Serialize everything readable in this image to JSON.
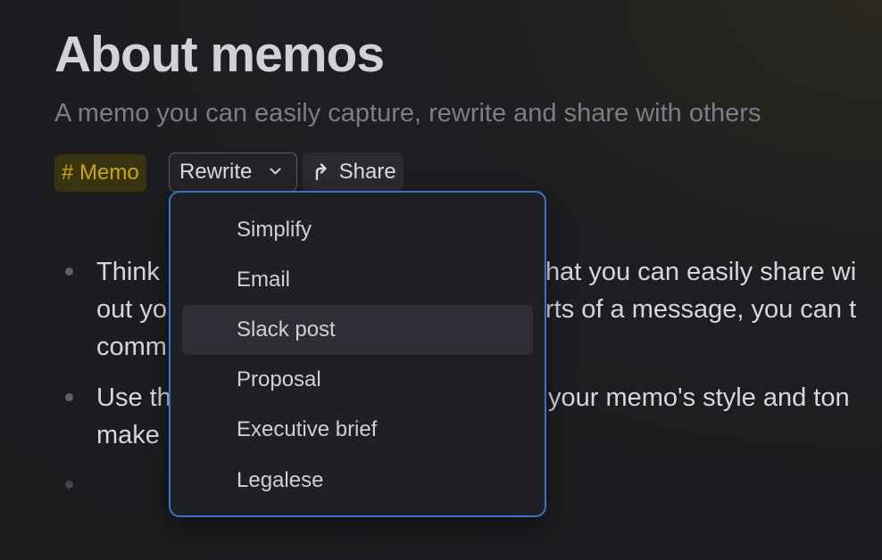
{
  "page": {
    "title": "About memos",
    "subtitle": "A memo you can easily capture, rewrite and share with others"
  },
  "toolbar": {
    "tag_label": "# Memo",
    "rewrite_label": "Rewrite",
    "rewrite_icon": "chevron-down-icon",
    "share_label": "Share",
    "share_icon": "share-icon"
  },
  "content": {
    "bullets": [
      {
        "lines": [
          "Think",
          "out yo",
          "comm"
        ],
        "lines_right": [
          "hat you can easily share wi",
          "rts of a message, you can t",
          ""
        ]
      },
      {
        "lines": [
          "Use th",
          "make"
        ],
        "lines_right": [
          "your memo's style and ton",
          ""
        ]
      },
      {
        "lines": [
          ""
        ],
        "lines_right": [
          ""
        ]
      }
    ]
  },
  "rewrite_menu": {
    "items": [
      {
        "label": "Simplify",
        "active": false
      },
      {
        "label": "Email",
        "active": false
      },
      {
        "label": "Slack post",
        "active": true
      },
      {
        "label": "Proposal",
        "active": false
      },
      {
        "label": "Executive brief",
        "active": false
      },
      {
        "label": "Legalese",
        "active": false
      }
    ]
  },
  "colors": {
    "background": "#1c1c1f",
    "tag_background": "#3a3310",
    "tag_text": "#c9a713",
    "menu_border": "#3b73c4",
    "menu_active": "#2e2f36"
  }
}
